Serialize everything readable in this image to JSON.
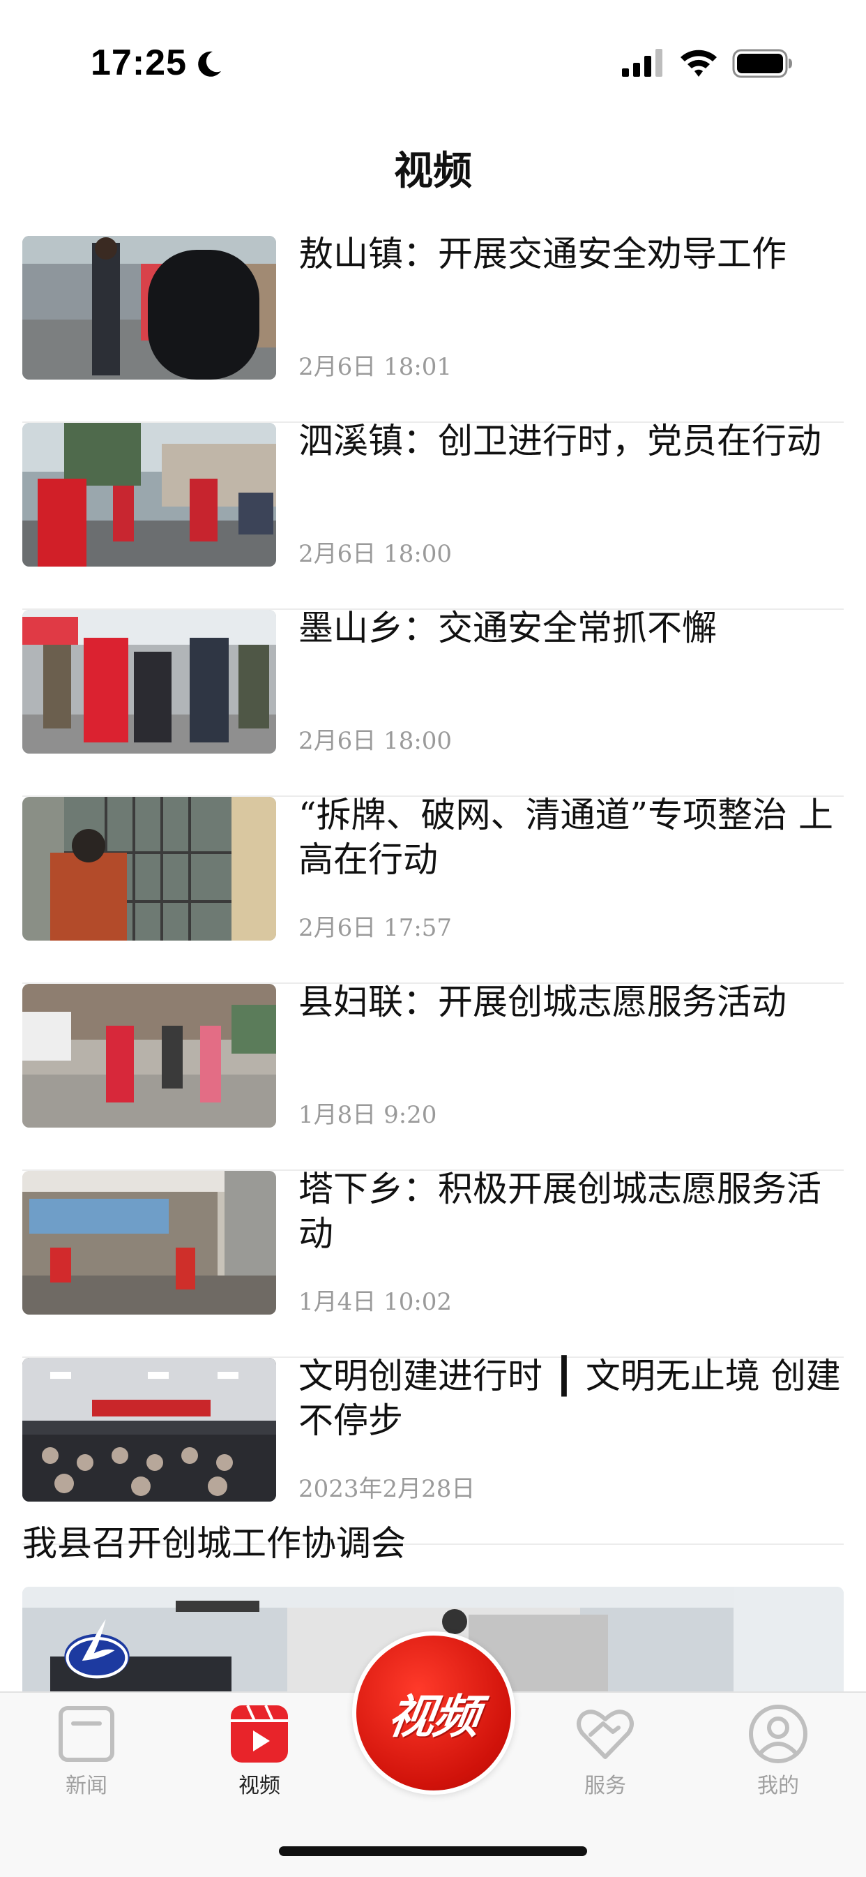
{
  "status_bar": {
    "time": "17:25"
  },
  "header": {
    "title": "视频"
  },
  "news": [
    {
      "title": "敖山镇：开展交通安全劝导工作",
      "date": "2月6日  18:01"
    },
    {
      "title": "泗溪镇：创卫进行时，党员在行动",
      "date": "2月6日  18:00"
    },
    {
      "title": "墨山乡：交通安全常抓不懈",
      "date": "2月6日  18:00"
    },
    {
      "title": "“拆牌、破网、清通道”专项整治  上高在行动",
      "date": "2月6日  17:57"
    },
    {
      "title": "县妇联：开展创城志愿服务活动",
      "date": "1月8日  9:20"
    },
    {
      "title": "塔下乡：积极开展创城志愿服务活动",
      "date": "1月4日  10:02"
    },
    {
      "title": "文明创建进行时 ┃  文明无止境 创建不停步",
      "date": "2023年2月28日"
    }
  ],
  "featured": {
    "title": "我县召开创城工作协调会"
  },
  "tabs": [
    {
      "label": "新闻",
      "icon": "news-icon",
      "active": false
    },
    {
      "label": "视频",
      "icon": "video-tab-icon",
      "active": true
    },
    {
      "label": "服务",
      "icon": "service-heart-icon",
      "active": false
    },
    {
      "label": "我的",
      "icon": "profile-icon",
      "active": false
    }
  ],
  "center_button": {
    "label": "视频"
  },
  "colors": {
    "accent": "#e8242a",
    "muted": "#a0a0a0",
    "date": "#9a9a9a"
  }
}
